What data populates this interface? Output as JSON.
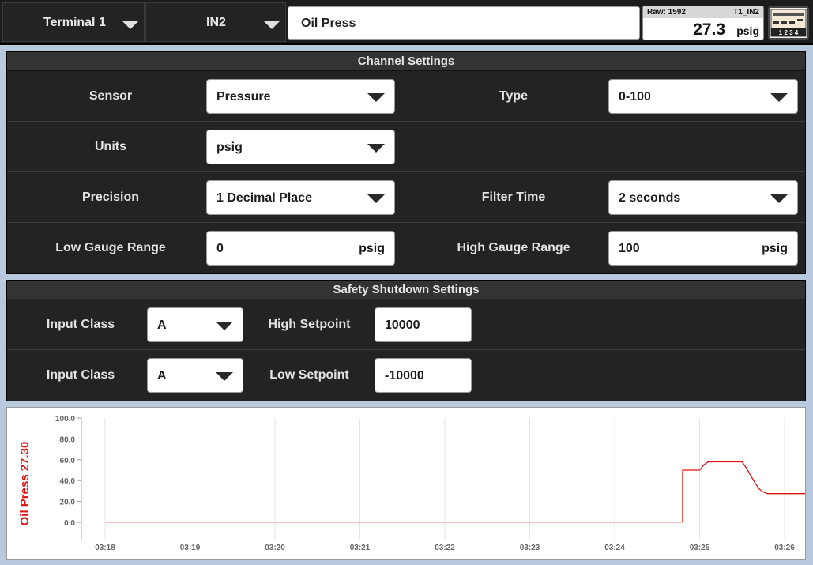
{
  "topbar": {
    "terminal_select": "Terminal 1",
    "input_select": "IN2",
    "tag_name": "Oil Press",
    "readout": {
      "raw_label": "Raw: 1592",
      "channel_id": "T1_IN2",
      "value": "27.3",
      "unit": "psig"
    },
    "terminal_icon_labels": "1 2 3 4"
  },
  "channel_settings": {
    "title": "Channel Settings",
    "sensor_label": "Sensor",
    "sensor_value": "Pressure",
    "type_label": "Type",
    "type_value": "0-100",
    "units_label": "Units",
    "units_value": "psig",
    "precision_label": "Precision",
    "precision_value": "1 Decimal Place",
    "filter_label": "Filter Time",
    "filter_value": "2 seconds",
    "low_range_label": "Low Gauge Range",
    "low_range_value": "0",
    "low_range_unit": "psig",
    "high_range_label": "High Gauge Range",
    "high_range_value": "100",
    "high_range_unit": "psig"
  },
  "safety_settings": {
    "title": "Safety Shutdown Settings",
    "high_class_label": "Input Class",
    "high_class_value": "A",
    "high_setpoint_label": "High Setpoint",
    "high_setpoint_value": "10000",
    "low_class_label": "Input Class",
    "low_class_value": "A",
    "low_setpoint_label": "Low Setpoint",
    "low_setpoint_value": "-10000"
  },
  "colors": {
    "accent_red": "#e01010",
    "panel_dark": "#232323",
    "background": "#b9c9dd"
  },
  "chart_data": {
    "type": "line",
    "ylabel": "Oil Press 27.30",
    "ylim": [
      0,
      100
    ],
    "yticks": [
      "0.0",
      "20.0",
      "40.0",
      "60.0",
      "80.0",
      "100.0"
    ],
    "xticks": [
      "03:18",
      "03:19",
      "03:20",
      "03:21",
      "03:22",
      "03:23",
      "03:24",
      "03:25",
      "03:26"
    ],
    "series": [
      {
        "color": "#e01010",
        "x": [
          0,
          6.8,
          6.8,
          7.0,
          7.05,
          7.1,
          7.5,
          7.55,
          7.6,
          7.65,
          7.7,
          7.75,
          7.8,
          8.5
        ],
        "y": [
          0.3,
          0.3,
          50,
          50,
          55,
          58,
          58,
          52,
          45,
          38,
          32,
          29,
          27.5,
          27.5
        ]
      }
    ]
  }
}
